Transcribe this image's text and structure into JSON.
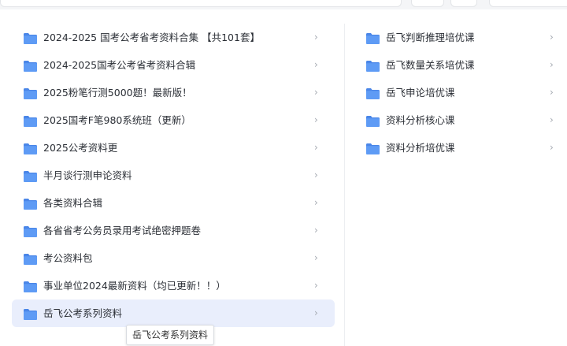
{
  "colors": {
    "folder": "#5e9bf5",
    "folder_dark": "#4a86e8",
    "active_bg": "#e9eefc"
  },
  "left_folders": [
    {
      "label": "2024-2025 国考公考省考资料合集 【共101套】",
      "icon": "folder-icon"
    },
    {
      "label": "2024-2025国考公考省考资料合辑",
      "icon": "folder-icon"
    },
    {
      "label": "2025粉笔行测5000题！最新版！",
      "icon": "folder-icon"
    },
    {
      "label": "2025国考F笔980系统班（更新）",
      "icon": "folder-icon"
    },
    {
      "label": "2025公考资料更",
      "icon": "folder-icon"
    },
    {
      "label": "半月谈行测申论资料",
      "icon": "folder-icon"
    },
    {
      "label": "各类资料合辑",
      "icon": "folder-icon"
    },
    {
      "label": "各省省考公务员录用考试绝密押题卷",
      "icon": "folder-icon"
    },
    {
      "label": "考公资料包",
      "icon": "folder-icon"
    },
    {
      "label": "事业单位2024最新资料（均已更新！！）",
      "icon": "folder-icon"
    },
    {
      "label": "岳飞公考系列资料",
      "icon": "folder-icon"
    }
  ],
  "right_folders": [
    {
      "label": "岳飞判断推理培优课",
      "icon": "folder-icon"
    },
    {
      "label": "岳飞数量关系培优课",
      "icon": "folder-icon"
    },
    {
      "label": "岳飞申论培优课",
      "icon": "folder-icon"
    },
    {
      "label": "资料分析核心课",
      "icon": "folder-icon"
    },
    {
      "label": "资料分析培优课",
      "icon": "folder-icon"
    }
  ],
  "chevron": "›",
  "tooltip": "岳飞公考系列资料"
}
